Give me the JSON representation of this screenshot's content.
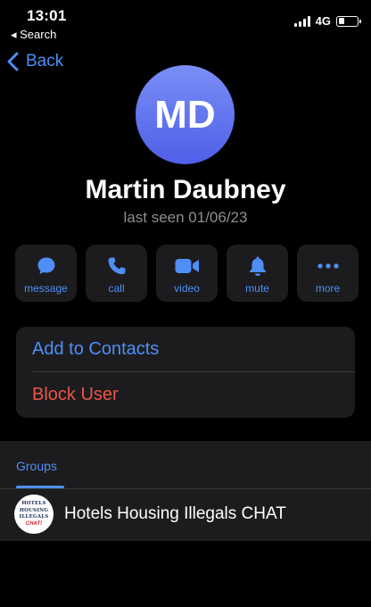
{
  "status_bar": {
    "time": "13:01",
    "back_app": "◂ Search",
    "network": "4G"
  },
  "nav": {
    "back_label": "Back"
  },
  "profile": {
    "initials": "MD",
    "name": "Martin Daubney",
    "last_seen": "last seen 01/06/23",
    "avatar_color": "#5b6cf0"
  },
  "actions": [
    {
      "label": "message",
      "icon": "message-icon"
    },
    {
      "label": "call",
      "icon": "phone-icon"
    },
    {
      "label": "video",
      "icon": "video-icon"
    },
    {
      "label": "mute",
      "icon": "bell-icon"
    },
    {
      "label": "more",
      "icon": "more-icon"
    }
  ],
  "contact_options": {
    "add": "Add to Contacts",
    "block": "Block User"
  },
  "groups": {
    "tab_label": "Groups",
    "items": [
      {
        "name": "Hotels Housing Illegals CHAT",
        "avatar_lines": [
          "HOTELS",
          "HOUSING",
          "ILLEGALS",
          "CHAT!"
        ]
      }
    ]
  },
  "colors": {
    "accent": "#4f8ef7",
    "destructive": "#eb5545",
    "card": "#1c1c1e",
    "secondary_text": "#8e8e93"
  }
}
